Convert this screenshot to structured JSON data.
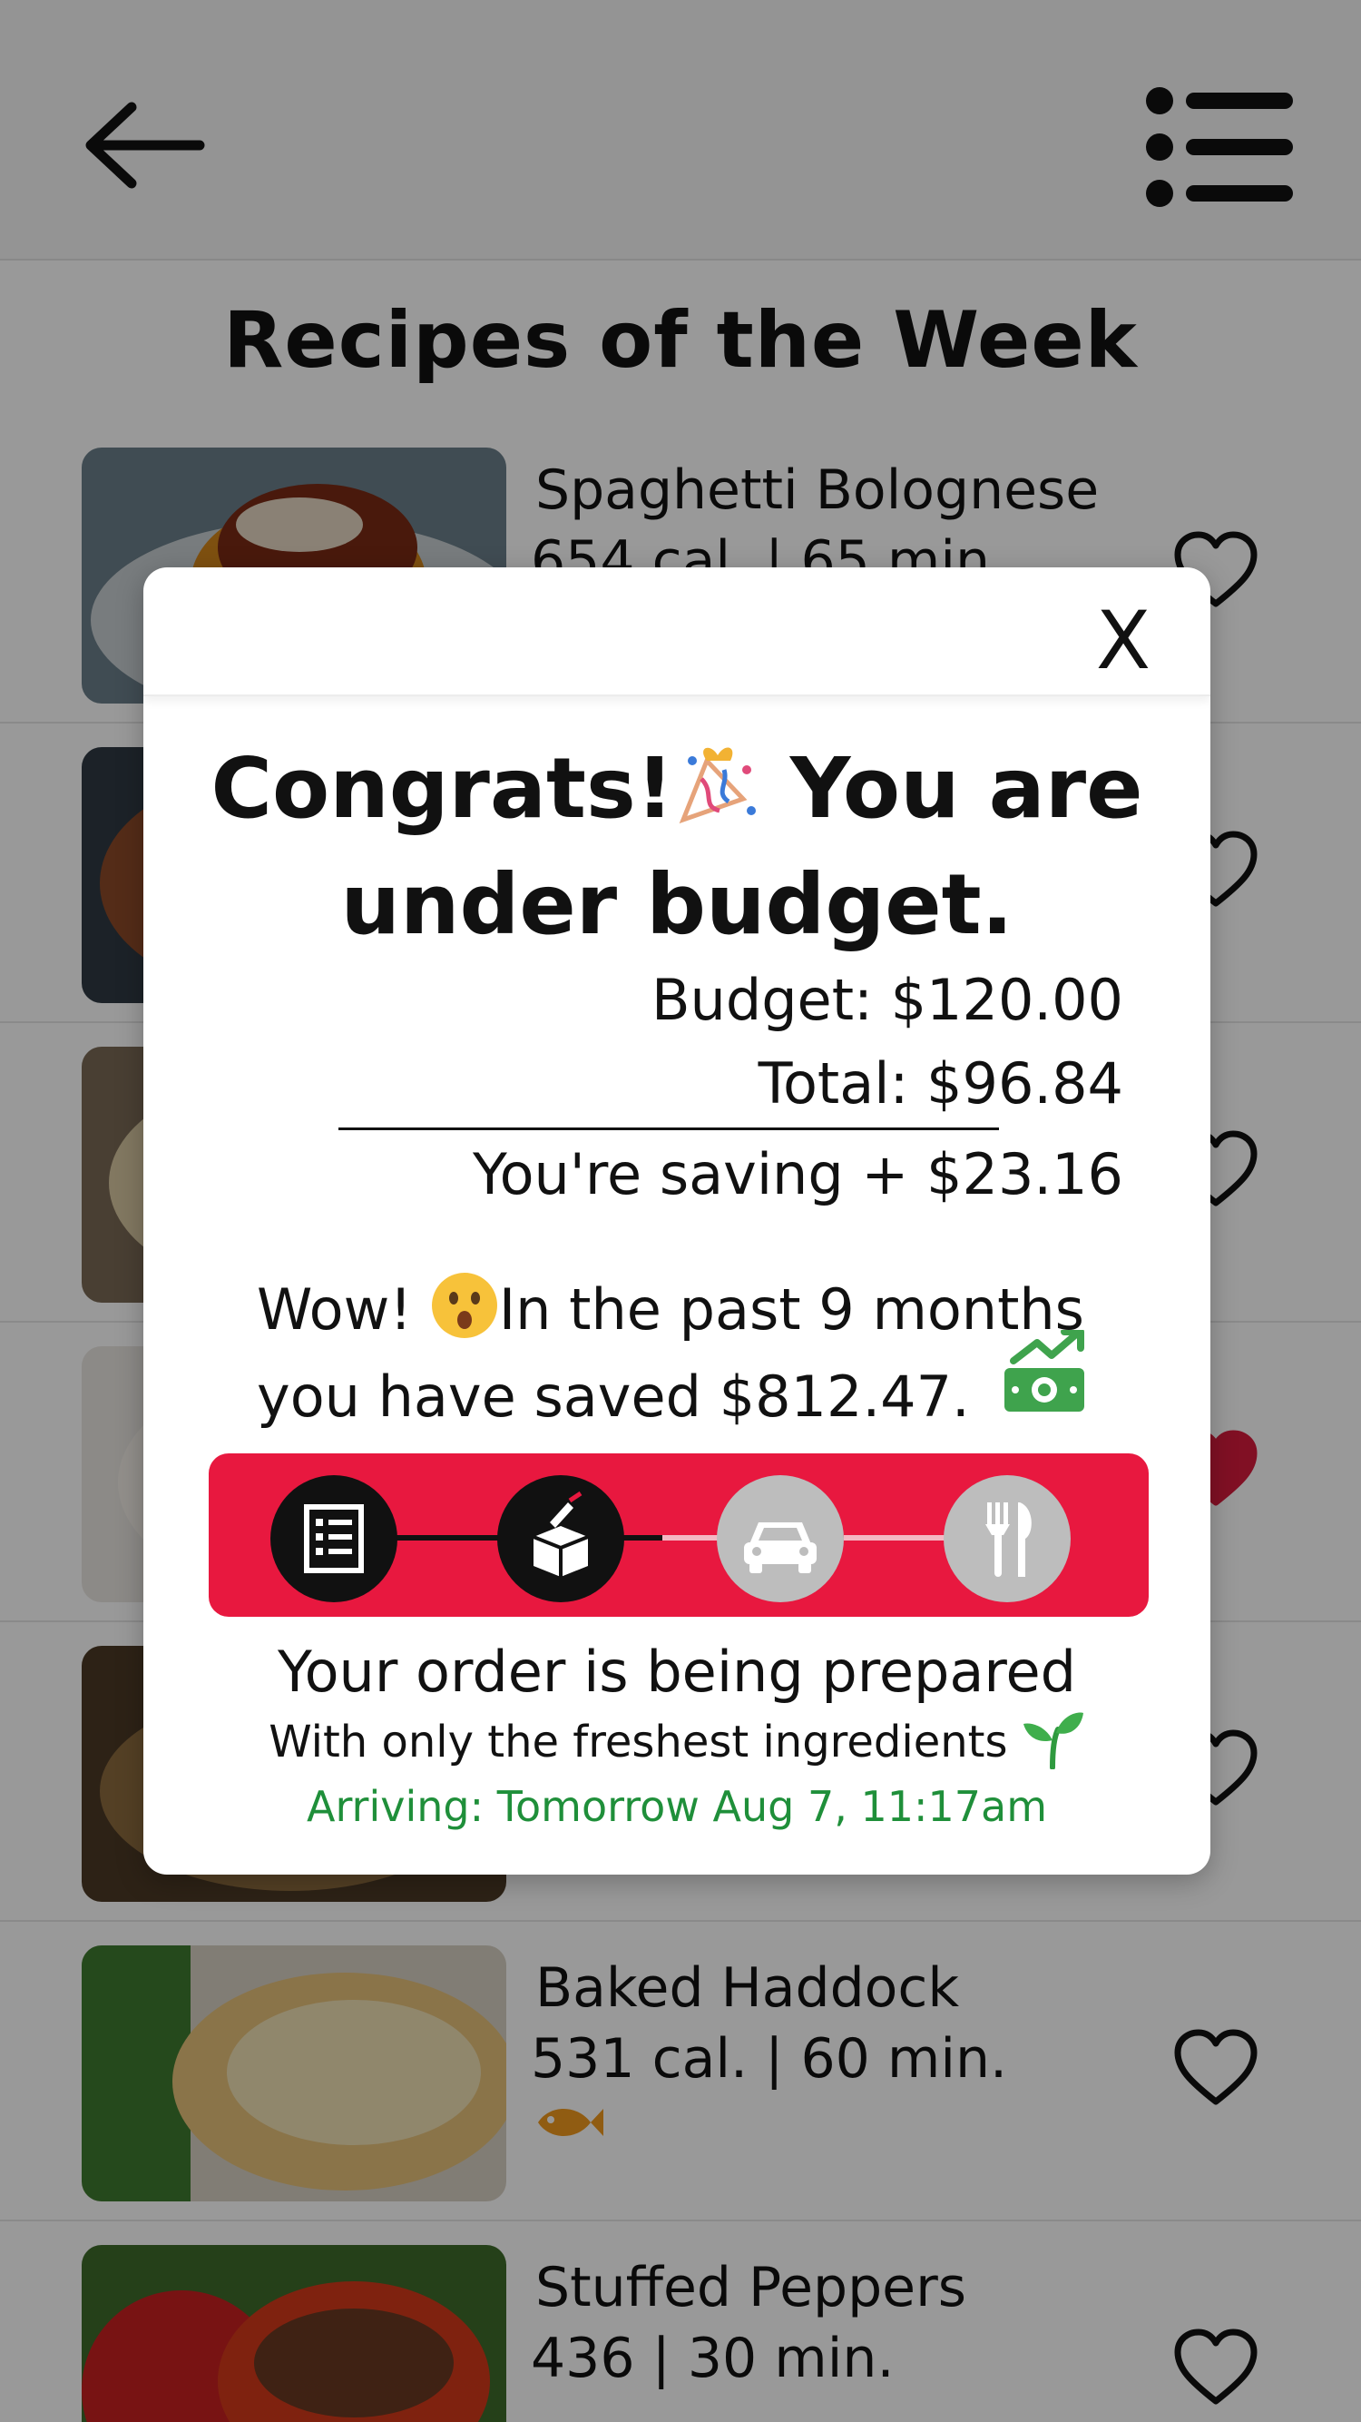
{
  "header": {
    "back_icon": "arrow-left-icon",
    "menu_icon": "list-menu-icon"
  },
  "page": {
    "title": "Recipes of the Week"
  },
  "recipes": [
    {
      "name": "Spaghetti Bolognese",
      "meta": "654 cal. | 65 min.",
      "favorited": false
    },
    {
      "name": "",
      "meta": "",
      "favorited": false
    },
    {
      "name": "",
      "meta": "",
      "favorited": false
    },
    {
      "name": "",
      "meta": "",
      "favorited": true
    },
    {
      "name": "",
      "meta": "",
      "favorited": false
    },
    {
      "name": "Baked Haddock",
      "meta": "531 cal. | 60 min.",
      "tag_icon": "fish-icon",
      "favorited": false
    },
    {
      "name": "Stuffed Peppers",
      "meta": "436 | 30 min.",
      "favorited": false
    }
  ],
  "modal": {
    "close_label": "X",
    "congrats_line1": "Congrats!",
    "congrats_line2": "You are",
    "congrats_line3": "under budget.",
    "budget_line": "Budget: $120.00",
    "total_line": "Total: $96.84",
    "saving_line": "You're saving + $23.16",
    "wow_prefix": "Wow!",
    "wow_rest": "In the past 9 months",
    "saved_line": "you have saved $812.47.",
    "status_title": "Your order is being prepared",
    "status_sub": "With only the freshest ingredients",
    "arrival": "Arriving: Tomorrow Aug 7, 11:17am"
  },
  "tracker": {
    "steps": [
      {
        "icon": "receipt-icon",
        "done": true
      },
      {
        "icon": "package-icon",
        "done": true
      },
      {
        "icon": "car-icon",
        "done": false
      },
      {
        "icon": "fork-knife-icon",
        "done": false
      }
    ]
  },
  "colors": {
    "tracker_bg": "#e8183f",
    "arrival_text": "#1f8f3a",
    "heart_filled": "#d81b3c"
  }
}
